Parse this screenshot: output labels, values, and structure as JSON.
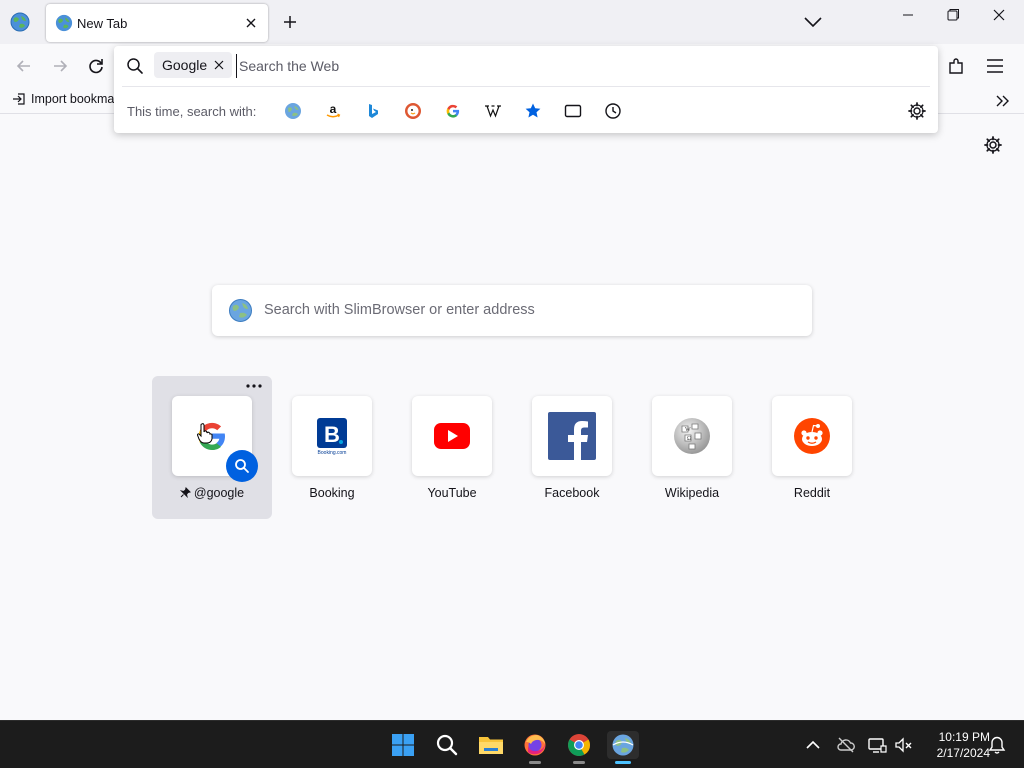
{
  "tabs": [
    {
      "title": "New Tab"
    }
  ],
  "icons": {
    "app": "globe-icon",
    "close": "close-icon",
    "new_tab": "plus-icon",
    "tab_list": "chevron-down-icon",
    "minimize": "minimize-icon",
    "maximize": "restore-icon",
    "window_close": "close-icon",
    "back": "arrow-left-icon",
    "forward": "arrow-right-icon",
    "reload": "reload-icon",
    "extensions": "puzzle-icon",
    "menu": "hamburger-icon",
    "bookmark_overflow": "double-chevron-icon",
    "settings": "gear-icon"
  },
  "bookmarks": {
    "import_label": "Import bookmarks..."
  },
  "url_dropdown": {
    "engine_chip": "Google",
    "input_placeholder": "Search the Web",
    "oneoff_label": "This time, search with:",
    "oneoff_engines": [
      "slimbrowser",
      "amazon",
      "bing",
      "duckduckgo",
      "google",
      "wikipedia",
      "bookmarks",
      "tabs",
      "history"
    ]
  },
  "main": {
    "search_placeholder": "Search with SlimBrowser or enter address",
    "shortcuts": [
      {
        "label": "@google",
        "pinned": true,
        "active": true
      },
      {
        "label": "Booking"
      },
      {
        "label": "YouTube"
      },
      {
        "label": "Facebook"
      },
      {
        "label": "Wikipedia"
      },
      {
        "label": "Reddit"
      }
    ]
  },
  "taskbar": {
    "time": "10:19 PM",
    "date": "2/17/2024"
  },
  "colors": {
    "accent": "#0061e0",
    "tabbar": "#f0f0f4",
    "page": "#f9f9fb",
    "taskbar": "#1c1c1c"
  }
}
